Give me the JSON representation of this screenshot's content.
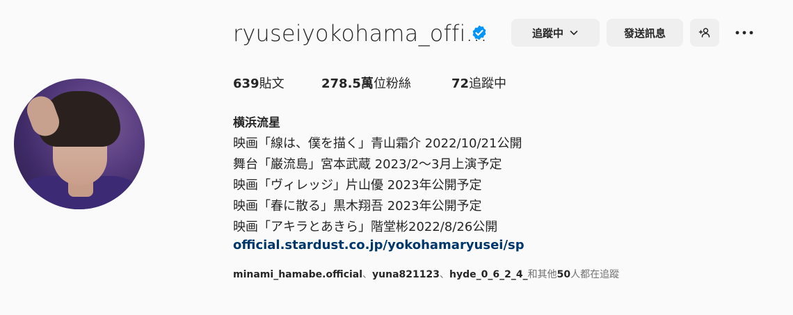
{
  "profile": {
    "username": "ryuseiyokohama_offi...",
    "verified": true,
    "accent_color": "#0095f6",
    "avatar_icon": "profile-photo"
  },
  "actions": {
    "following_label": "追蹤中",
    "message_label": "發送訊息",
    "add_user_icon": "add-user-icon",
    "more_icon": "more-options-icon"
  },
  "stats": {
    "posts_count": "639",
    "posts_label": "貼文",
    "followers_count": "278.5萬",
    "followers_label": "位粉絲",
    "following_count": "72",
    "following_label": "追蹤中"
  },
  "bio": {
    "full_name": "横浜流星",
    "lines": [
      "映画「線は、僕を描く」青山霜介 2022/10/21公開",
      "舞台「巌流島」宮本武蔵 2023/2～3月上演予定",
      "映画「ヴィレッジ」片山優 2023年公開予定",
      "映画「春に散る」黒木翔吾 2023年公開予定",
      "映画「アキラとあきら」階堂彬2022/8/26公開"
    ],
    "link": "official.stardust.co.jp/yokohamaryusei/sp"
  },
  "followed_by": {
    "user1": "minami_hamabe.official",
    "sep1": "、",
    "user2": "yuna821123",
    "sep2": "、",
    "user3": "hyde_0_6_2_4_",
    "suffix_pre": "和其他",
    "others_count": "50",
    "suffix_post": "人都在追蹤"
  }
}
